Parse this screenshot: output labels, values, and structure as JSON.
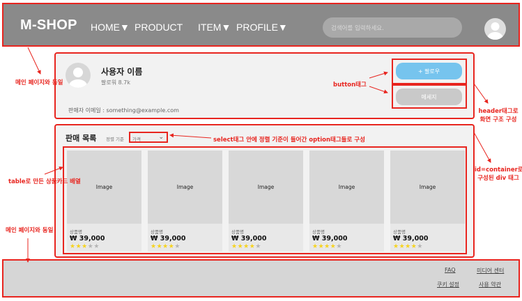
{
  "header": {
    "logo": "M-SHOP",
    "nav": [
      "HOME▼",
      "PRODUCT",
      "ITEM▼",
      "PROFILE▼"
    ],
    "search_placeholder": "검색어를 입력하세요."
  },
  "profile": {
    "username": "사용자 이름",
    "followers": "팔로워  8.7k",
    "email": "판매자 이메일 : something@example.com",
    "follow_label": "+ 팔로우",
    "message_label": "메세지"
  },
  "listing": {
    "title": "판매 목록",
    "sort_label": "정렬 기준",
    "sort_selected": "가격",
    "products": [
      {
        "image_label": "Image",
        "name": "상품명",
        "price": "₩ 39,000",
        "rating": 3
      },
      {
        "image_label": "Image",
        "name": "상품명",
        "price": "₩ 39,000",
        "rating": 4
      },
      {
        "image_label": "Image",
        "name": "상품명",
        "price": "₩ 39,000",
        "rating": 4
      },
      {
        "image_label": "Image",
        "name": "상품명",
        "price": "₩ 39,000",
        "rating": 4
      },
      {
        "image_label": "Image",
        "name": "상품명",
        "price": "₩ 39,000",
        "rating": 4
      }
    ]
  },
  "footer": {
    "faq": "FAQ",
    "media": "미디어 센터",
    "cookie": "쿠키 설정",
    "terms": "사용 약관"
  },
  "annotations": {
    "main_same_1": "메인 페이지와 동일",
    "button_tag": "button태그",
    "header_tag_1": "header태그로",
    "header_tag_2": "화면 구조 구성",
    "select_tag": "select태그 안에 정렬 기준이 들어간 option태그들로 구성",
    "container_1": "id=container로",
    "container_2": "구성된 div 태그",
    "table_cards": "table로 만든 상품카드 배열",
    "main_same_2": "메인 페이지와 동일"
  },
  "colors": {
    "header_bg": "#8a8a8a",
    "annotation_red": "#e8251f",
    "follow_button": "#76c4ee",
    "message_button": "#c9c9c9",
    "star_filled": "#f6d31f",
    "star_empty": "#b5b5b5"
  }
}
